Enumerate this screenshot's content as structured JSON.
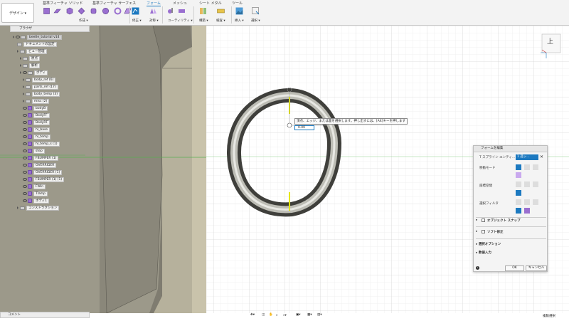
{
  "toolbar": {
    "design_label": "デザイン ▾",
    "tabs": [
      "基準フィーチャ ソリッド",
      "基準フィーチャ サーフェス",
      "フォーム",
      "メッシュ",
      "シート メタル",
      "ツール"
    ],
    "groups": [
      "作成 ▾",
      "修正 ▾",
      "対称 ▾",
      "ユーティリティ ▾",
      "構築 ▾",
      "検査 ▾",
      "挿入 ▾",
      "選択 ▾"
    ]
  },
  "browser": {
    "title": "ブラウザ",
    "items": [
      {
        "label": "beetle_tutorial v14",
        "type": "root"
      },
      {
        "label": "ドキュメントの設定",
        "type": "settings"
      },
      {
        "label": "ビュー管理",
        "type": "folder"
      },
      {
        "label": "原点",
        "type": "folder"
      },
      {
        "label": "解析",
        "type": "folder"
      },
      {
        "label": "ボディ",
        "type": "folder"
      },
      {
        "label": "body_ref (6)",
        "type": "folder"
      },
      {
        "label": "parts_ref (17)",
        "type": "folder"
      },
      {
        "label": "body_temp (3)",
        "type": "folder"
      },
      {
        "label": "misc (2)",
        "type": "folder"
      },
      {
        "label": "bodyB",
        "type": "body"
      },
      {
        "label": "BodyFF",
        "type": "body"
      },
      {
        "label": "BodyRF",
        "type": "body"
      },
      {
        "label": "hl_base",
        "type": "body"
      },
      {
        "label": "hl_temp",
        "type": "body"
      },
      {
        "label": "hl_temp_s (1)",
        "type": "body"
      },
      {
        "label": "step",
        "type": "body"
      },
      {
        "label": "FBUMPER (1)",
        "type": "body"
      },
      {
        "label": "OVERRIDER",
        "type": "body"
      },
      {
        "label": "OVERRIDER (1)",
        "type": "body"
      },
      {
        "label": "FBUMPER (1) (1)",
        "type": "body"
      },
      {
        "label": "FWin",
        "type": "body"
      },
      {
        "label": "Tlamp",
        "type": "body"
      },
      {
        "label": "ボディ1",
        "type": "body"
      },
      {
        "label": "コンストラクション",
        "type": "folder"
      }
    ]
  },
  "comments_label": "コメント",
  "viewcube_label": "上",
  "tooltip_text": "頂点、エッジ、または面を選択します。押し出すには、[Alt]キーを押します",
  "value_input": "0.00",
  "dialog": {
    "title": "フォームを編集",
    "spline_label": "T スプライン エンティ...",
    "select_value": "1 选ッ...",
    "move_mode_label": "移動モード",
    "coord_label": "座標空間",
    "filter_label": "選択フィルタ",
    "object_snap_label": "オブジェクト スナップ",
    "soft_modify_label": "ソフト修正",
    "select_options_label": "選択オプション",
    "numeric_input_label": "数値入力",
    "ok_label": "OK",
    "cancel_label": "キャンセル"
  },
  "status_text": "複数選択",
  "colors": {
    "accent": "#1c79c0",
    "body_purple": "#9a6fd0",
    "model_surface": "#9d9a86",
    "yellow_edge": "#e6e600"
  }
}
